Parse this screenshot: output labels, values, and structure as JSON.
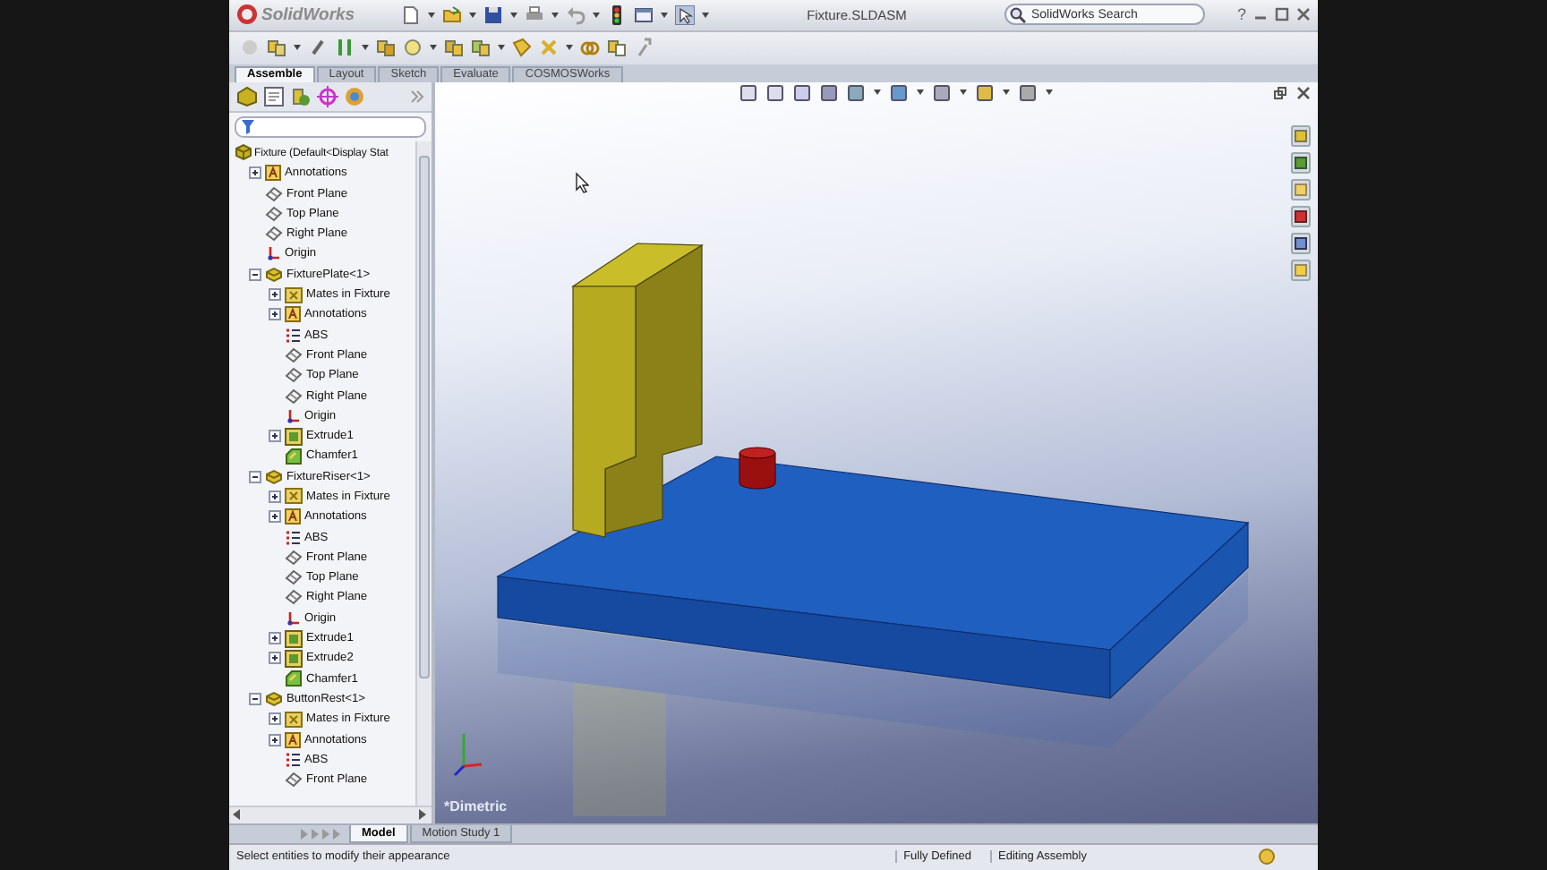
{
  "app": {
    "logo": "SolidWorks",
    "title": "Fixture.SLDASM",
    "search_placeholder": "SolidWorks Search",
    "help": "?"
  },
  "command_tabs": [
    {
      "label": "Assemble",
      "selected": true
    },
    {
      "label": "Layout",
      "selected": false
    },
    {
      "label": "Sketch",
      "selected": false
    },
    {
      "label": "Evaluate",
      "selected": false
    },
    {
      "label": "COSMOSWorks",
      "selected": false
    }
  ],
  "tree": {
    "items": [
      {
        "label": "Fixture  (Default<Display Stat",
        "kind": "assembly",
        "children": [
          {
            "label": "Annotations",
            "kind": "annotations",
            "expanded": false
          },
          {
            "label": "Front Plane",
            "kind": "plane"
          },
          {
            "label": "Top Plane",
            "kind": "plane"
          },
          {
            "label": "Right Plane",
            "kind": "plane"
          },
          {
            "label": "Origin",
            "kind": "origin"
          },
          {
            "label": "FixturePlate<1>",
            "kind": "part",
            "expanded": true,
            "children": [
              {
                "label": "Mates in Fixture",
                "kind": "mates",
                "expanded": false
              },
              {
                "label": "Annotations",
                "kind": "annotations",
                "expanded": false
              },
              {
                "label": "ABS",
                "kind": "list"
              },
              {
                "label": "Front Plane",
                "kind": "plane"
              },
              {
                "label": "Top Plane",
                "kind": "plane"
              },
              {
                "label": "Right Plane",
                "kind": "plane"
              },
              {
                "label": "Origin",
                "kind": "origin"
              },
              {
                "label": "Extrude1",
                "kind": "extrude",
                "expanded": false
              },
              {
                "label": "Chamfer1",
                "kind": "chamfer"
              }
            ]
          },
          {
            "label": "FixtureRiser<1>",
            "kind": "part",
            "expanded": true,
            "children": [
              {
                "label": "Mates in Fixture",
                "kind": "mates",
                "expanded": false
              },
              {
                "label": "Annotations",
                "kind": "annotations",
                "expanded": false
              },
              {
                "label": "ABS",
                "kind": "list"
              },
              {
                "label": "Front Plane",
                "kind": "plane"
              },
              {
                "label": "Top Plane",
                "kind": "plane"
              },
              {
                "label": "Right Plane",
                "kind": "plane"
              },
              {
                "label": "Origin",
                "kind": "origin"
              },
              {
                "label": "Extrude1",
                "kind": "extrude",
                "expanded": false
              },
              {
                "label": "Extrude2",
                "kind": "extrude",
                "expanded": false
              },
              {
                "label": "Chamfer1",
                "kind": "chamfer"
              }
            ]
          },
          {
            "label": "ButtonRest<1>",
            "kind": "part",
            "expanded": true,
            "children": [
              {
                "label": "Mates in Fixture",
                "kind": "mates",
                "expanded": false
              },
              {
                "label": "Annotations",
                "kind": "annotations",
                "expanded": false
              },
              {
                "label": "ABS",
                "kind": "list"
              },
              {
                "label": "Front Plane",
                "kind": "plane"
              }
            ]
          }
        ]
      }
    ]
  },
  "viewport": {
    "view_label": "*Dimetric"
  },
  "bottom_tabs": [
    {
      "label": "Model",
      "selected": true
    },
    {
      "label": "Motion Study 1",
      "selected": false
    }
  ],
  "status_bar": {
    "message": "Select entities to modify their appearance",
    "fields": [
      "Fully Defined",
      "Editing Assembly"
    ]
  }
}
